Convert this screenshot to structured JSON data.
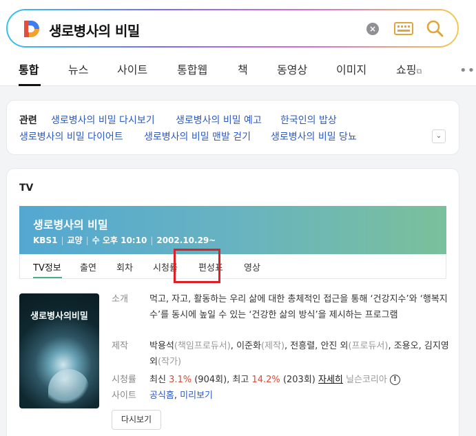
{
  "search": {
    "query": "생로병사의 비밀",
    "clear_icon": "×"
  },
  "tabs": [
    {
      "label": "통합"
    },
    {
      "label": "뉴스"
    },
    {
      "label": "사이트"
    },
    {
      "label": "통합웹"
    },
    {
      "label": "책"
    },
    {
      "label": "동영상"
    },
    {
      "label": "이미지"
    },
    {
      "label": "쇼핑"
    }
  ],
  "more_icon": "•••",
  "related": {
    "label": "관련",
    "links": [
      "생로병사의 비밀 다시보기",
      "생로병사의 비밀 예고",
      "한국인의 밥상",
      "생로병사의 비밀 다이어트",
      "생로병사의 비밀 맨발 걷기",
      "생로병사의 비밀 당뇨"
    ],
    "expand_icon": "⌄"
  },
  "tv": {
    "label": "TV",
    "title": "생로병사의 비밀",
    "meta": {
      "channel": "KBS1",
      "genre": "교양",
      "schedule": "수 오후 10:10",
      "start": "2002.10.29~"
    },
    "subtabs": [
      "TV정보",
      "출연",
      "회차",
      "시청률",
      "편성표",
      "영상"
    ],
    "poster_title": "생로병사의비밀",
    "info": {
      "intro_key": "소개",
      "intro_val": "먹고, 자고, 활동하는 우리 삶에 대한 총체적인 접근을 통해 ‘건강지수’와 ‘행복지수’를 동시에 높일 수 있는 ‘건강한 삶의 방식’을 제시하는 프로그램",
      "producer_key": "제작",
      "producer_1": "박용석",
      "producer_1_role": "(책임프로듀서)",
      "producer_2": "이준화",
      "producer_2_role": "(제작)",
      "producer_3": "전흥렬, 안진 외",
      "producer_3_role": "(프로듀서)",
      "producer_4": "조용오, 김지영 외",
      "producer_4_role": "(작가)",
      "rating_key": "시청률",
      "rating_latest_label": "최신",
      "rating_latest": "3.1%",
      "rating_latest_ep": "(904회)",
      "rating_best_label": "최고",
      "rating_best": "14.2%",
      "rating_best_ep": "(203회)",
      "rating_more": "자세히",
      "rating_source": "닐슨코리아",
      "site_key": "사이트",
      "site_home": "공식홈",
      "site_preview": "미리보기"
    },
    "rewatch": "다시보기"
  }
}
